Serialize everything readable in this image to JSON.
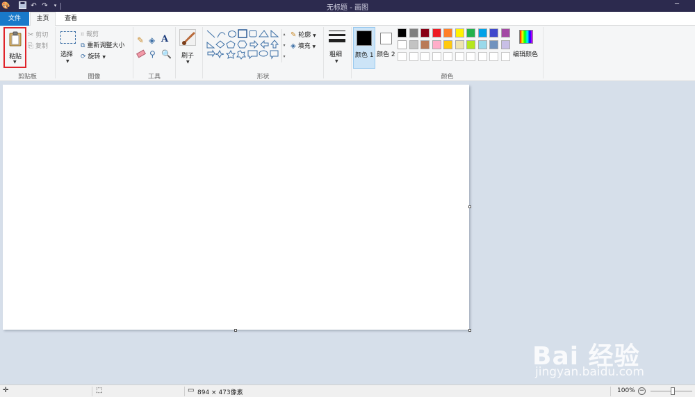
{
  "window": {
    "title": "无标题 - 画图"
  },
  "tabs": {
    "file": "文件",
    "home": "主页",
    "view": "查看"
  },
  "clipboard": {
    "paste": "粘贴",
    "cut": "剪切",
    "copy": "复制",
    "group": "剪贴板"
  },
  "image": {
    "select": "选择",
    "crop": "裁剪",
    "resize": "重新调整大小",
    "rotate": "旋转",
    "group": "图像"
  },
  "tools": {
    "group": "工具"
  },
  "brushes": {
    "label": "刷子"
  },
  "shapes": {
    "outline": "轮廓",
    "fill": "填充",
    "group": "形状"
  },
  "size": {
    "label": "粗细"
  },
  "colors": {
    "color1_label": "颜色 1",
    "color2_label": "颜色 2",
    "edit_label": "编辑颜色",
    "group": "颜色",
    "color1": "#000000",
    "color2": "#ffffff",
    "palette_row1": [
      "#000000",
      "#7f7f7f",
      "#880015",
      "#ed1c24",
      "#ff7f27",
      "#fff200",
      "#22b14c",
      "#00a2e8",
      "#3f48cc",
      "#a349a4"
    ],
    "palette_row2": [
      "#ffffff",
      "#c3c3c3",
      "#b97a57",
      "#ffaec9",
      "#ffc90e",
      "#efe4b0",
      "#b5e61d",
      "#99d9ea",
      "#7092be",
      "#c8bfe7"
    ]
  },
  "status": {
    "dimensions": "894 × 473像素",
    "zoom": "100%"
  },
  "watermark": {
    "logo": "Bai  经验",
    "url": "jingyan.baidu.com"
  }
}
